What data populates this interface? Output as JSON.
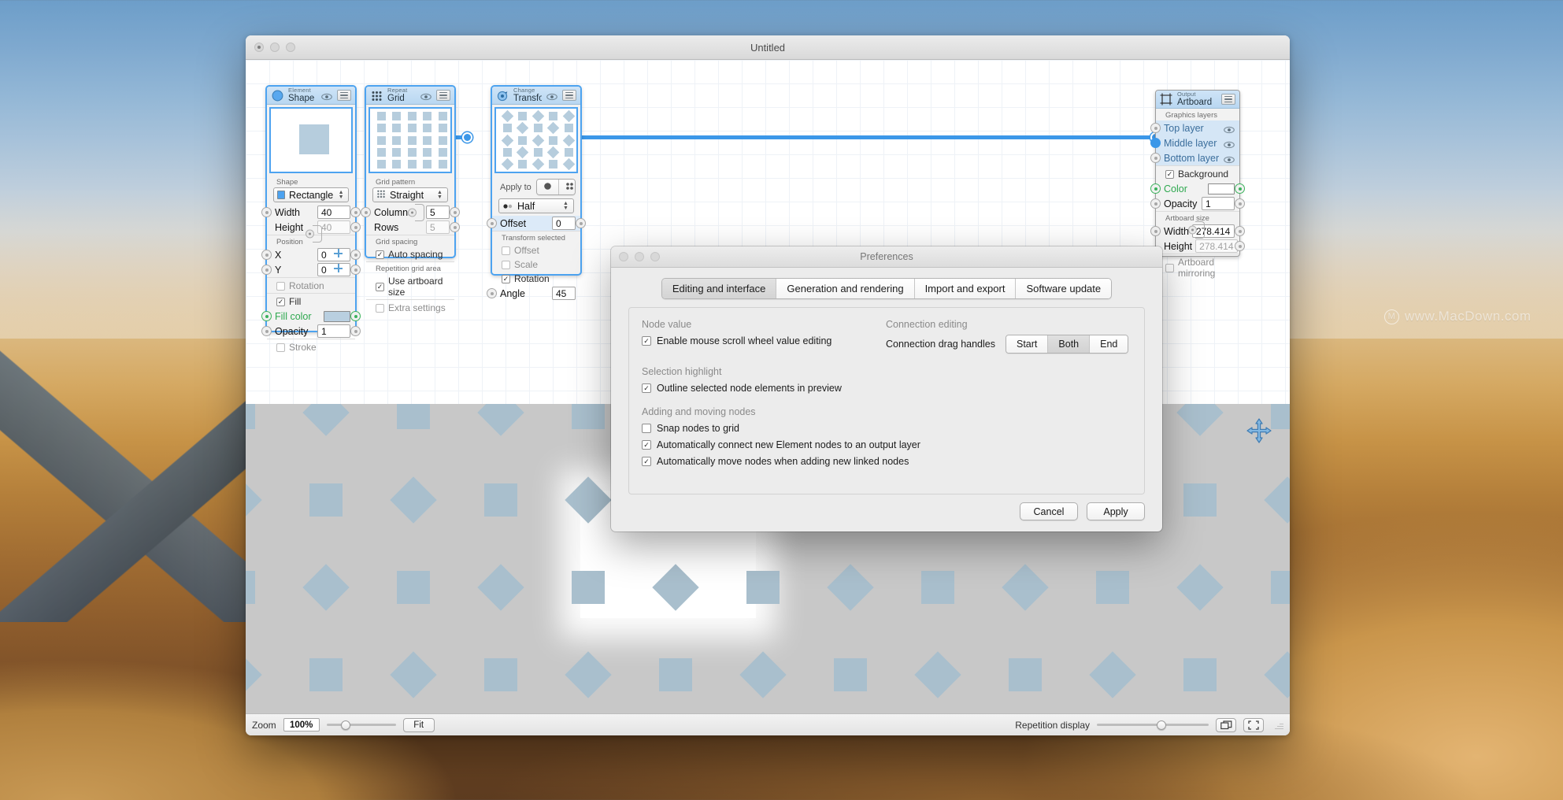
{
  "desktop": {
    "watermark": "www.MacDown.com",
    "watermark_icon": "m-logo-icon"
  },
  "window": {
    "title": "Untitled",
    "traffic": [
      "close-button",
      "minimize-button",
      "zoom-button"
    ]
  },
  "nodes": [
    {
      "id": "shape",
      "kind": "Element",
      "name": "Shape",
      "icon": "circle-icon",
      "eye": "eye-icon",
      "menu": "hamburger-icon",
      "section_shape": "Shape",
      "shape_popup": "Rectangle",
      "width_label": "Width",
      "width_value": "40",
      "height_label": "Height",
      "height_value": "40",
      "section_position": "Position",
      "x_label": "X",
      "x_value": "0",
      "y_label": "Y",
      "y_value": "0",
      "rotation_label": "Rotation",
      "rotation_checked": false,
      "fill_label": "Fill",
      "fill_checked": true,
      "fill_color_label": "Fill color",
      "opacity_label": "Opacity",
      "opacity_value": "1",
      "stroke_label": "Stroke",
      "stroke_checked": false
    },
    {
      "id": "grid",
      "kind": "Repeat",
      "name": "Grid",
      "icon": "dot-grid-icon",
      "eye": "eye-icon",
      "menu": "hamburger-icon",
      "section_pattern": "Grid pattern",
      "pattern_popup": "Straight",
      "columns_label": "Columns",
      "columns_value": "5",
      "rows_label": "Rows",
      "rows_value": "5",
      "section_spacing": "Grid spacing",
      "auto_spacing_label": "Auto spacing",
      "auto_spacing_checked": true,
      "section_area": "Repetition grid area",
      "use_artboard_label": "Use artboard size",
      "use_artboard_checked": true,
      "extra_settings_label": "Extra settings",
      "extra_settings_checked": false
    },
    {
      "id": "transform",
      "kind": "Change",
      "name": "Transform",
      "icon": "transform-target-icon",
      "eye": "eye-icon",
      "menu": "hamburger-icon",
      "apply_to_label": "Apply to",
      "apply_to_options": [
        "all-dots-icon",
        "four-dots-icon",
        "half-dots-icon"
      ],
      "apply_to_selected_index": 2,
      "selection_popup": "Half",
      "selection_popup_icon": "half-dots-icon",
      "offset_label": "Offset",
      "offset_value": "0",
      "section_transform_selected": "Transform selected",
      "t_offset_label": "Offset",
      "t_offset_checked": false,
      "t_scale_label": "Scale",
      "t_scale_checked": false,
      "t_rotation_label": "Rotation",
      "t_rotation_checked": true,
      "angle_label": "Angle",
      "angle_value": "45"
    },
    {
      "id": "artboard",
      "kind": "Output",
      "name": "Artboard",
      "icon": "artboard-frame-icon",
      "menu": "hamburger-icon",
      "section_layers": "Graphics layers",
      "layers": [
        "Top layer",
        "Middle layer",
        "Bottom layer"
      ],
      "layer_eye_icon": "eye-icon",
      "background_label": "Background",
      "background_checked": true,
      "color_label": "Color",
      "color_value": "#ffffff",
      "opacity_label": "Opacity",
      "opacity_value": "1",
      "section_size": "Artboard size",
      "width_label": "Width",
      "width_value": "278.414",
      "height_label": "Height",
      "height_value": "278.414",
      "mirroring_label": "Artboard mirroring",
      "mirroring_checked": false
    }
  ],
  "bottombar": {
    "zoom_label": "Zoom",
    "zoom_value": "100%",
    "zoom_slider_percent": 22,
    "fit_label": "Fit",
    "repetition_label": "Repetition display",
    "repetition_slider_percent": 58,
    "duplicate_icon": "duplicate-windows-icon",
    "fullscreen_icon": "fullscreen-icon",
    "resize_icon": "resize-grip-icon"
  },
  "canvas": {
    "gizmo_icon": "move-gizmo-icon",
    "background_color": "#c8c8c8",
    "shape_color": "#a9bfcd"
  },
  "preferences": {
    "title": "Preferences",
    "tabs": [
      {
        "label": "Editing and interface",
        "active": true
      },
      {
        "label": "Generation and rendering",
        "active": false
      },
      {
        "label": "Import and export",
        "active": false
      },
      {
        "label": "Software update",
        "active": false
      }
    ],
    "groups": {
      "node_value": {
        "title": "Node value",
        "scroll_wheel_label": "Enable mouse scroll wheel value editing",
        "scroll_wheel_checked": true
      },
      "connection_editing": {
        "title": "Connection editing",
        "drag_handles_label": "Connection drag handles",
        "segments": [
          "Start",
          "Both",
          "End"
        ],
        "selected_index": 1
      },
      "selection_highlight": {
        "title": "Selection highlight",
        "outline_label": "Outline selected node elements in preview",
        "outline_checked": true
      },
      "adding_moving": {
        "title": "Adding and moving nodes",
        "snap_label": "Snap nodes to grid",
        "snap_checked": false,
        "autoconnect_label": "Automatically connect new Element nodes to an output layer",
        "autoconnect_checked": true,
        "automove_label": "Automatically move nodes when adding new linked nodes",
        "automove_checked": true
      }
    },
    "cancel_label": "Cancel",
    "apply_label": "Apply"
  },
  "colors": {
    "accent_blue": "#3b97e8",
    "node_header": "#b9d7f1",
    "green_port": "#3cb25c",
    "shape_fill": "#b6cddd"
  }
}
